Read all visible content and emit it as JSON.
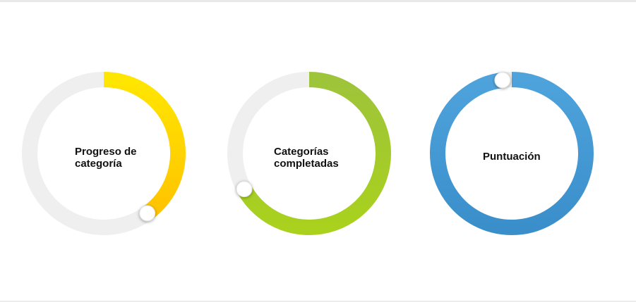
{
  "gauges": [
    {
      "label_lines": [
        "Progreso de",
        "categoría"
      ],
      "progress": 0.4,
      "colors": {
        "start": "#ffe600",
        "end": "#ffc300",
        "track": "#efefef"
      },
      "icon": "knob-handle"
    },
    {
      "label_lines": [
        "Categorías",
        "completadas"
      ],
      "progress": 0.67,
      "colors": {
        "start": "#9ec43a",
        "end": "#a9d11d",
        "track": "#efefef"
      },
      "icon": "knob-handle"
    },
    {
      "label_lines": [
        "Puntuación"
      ],
      "progress": 0.98,
      "colors": {
        "start": "#4fa3dc",
        "end": "#3a8fcb",
        "track": "#efefef"
      },
      "icon": "knob-handle"
    }
  ]
}
